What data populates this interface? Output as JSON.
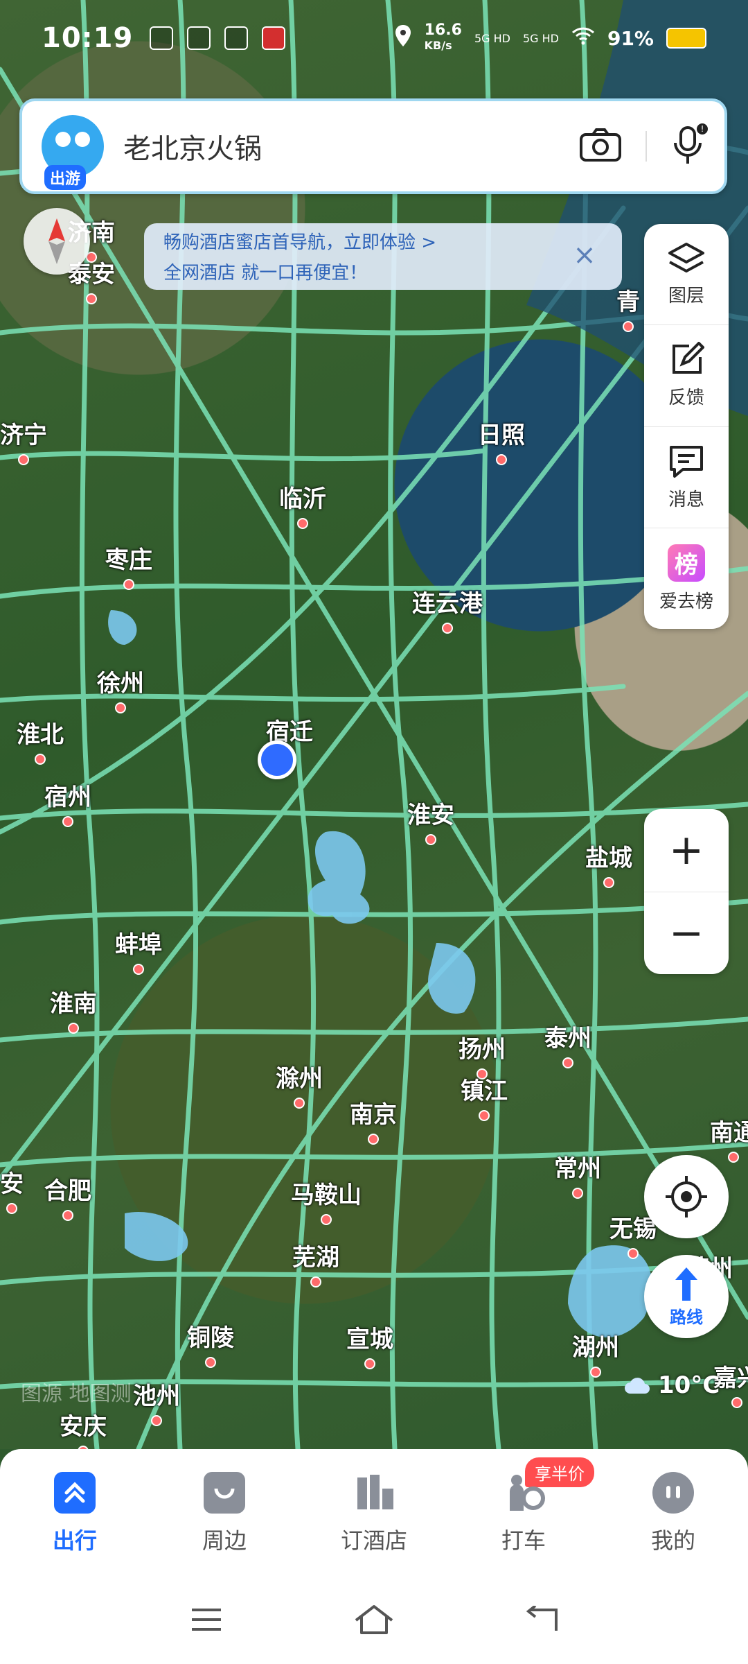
{
  "status_bar": {
    "time": "10:19",
    "net_speed": "16.6",
    "net_unit": "KB/s",
    "sig1": "5G HD",
    "sig2": "5G HD",
    "battery": "91%"
  },
  "search": {
    "query": "老北京火锅",
    "mascot_badge": "出游"
  },
  "notice": {
    "line1": "畅购酒店蜜店首导航，立即体验 >",
    "line2": "全网酒店 就一口再便宜！"
  },
  "toolbar": {
    "layers": "图层",
    "feedback": "反馈",
    "messages": "消息",
    "ranking_badge": "榜",
    "ranking": "爱去榜"
  },
  "zoom": {
    "in": "+",
    "out": "−"
  },
  "route": {
    "label": "路线"
  },
  "weather": {
    "temp": "10°C"
  },
  "watermark": "图源 地图测",
  "cities": {
    "jinan": "济南",
    "taian": "泰安",
    "qing": "青",
    "jining": "济宁",
    "rizhao": "日照",
    "linyi": "临沂",
    "zaozhuang": "枣庄",
    "lianyungang": "连云港",
    "xuzhou": "徐州",
    "huaibei": "淮北",
    "suqian": "宿迁",
    "suzhou": "宿州",
    "huaian": "淮安",
    "yancheng": "盐城",
    "bengbu": "蚌埠",
    "huainan": "淮南",
    "yangzhou": "扬州",
    "taizhou": "泰州",
    "chuzhou": "滁州",
    "zhenjiang": "镇江",
    "nanjing": "南京",
    "nantong": "南通",
    "an": "安",
    "hefei": "合肥",
    "maanshan": "马鞍山",
    "changzhou": "常州",
    "wuxi": "无锡",
    "suzhou2": "苏州",
    "wuhu": "芜湖",
    "tongling": "铜陵",
    "xuancheng": "宣城",
    "huzhou": "湖州",
    "jiaxing": "嘉兴",
    "chizhou": "池州",
    "anqing": "安庆"
  },
  "tabs": {
    "travel": "出行",
    "nearby": "周边",
    "hotel": "订酒店",
    "taxi": "打车",
    "taxi_promo": "享半价",
    "mine": "我的"
  }
}
